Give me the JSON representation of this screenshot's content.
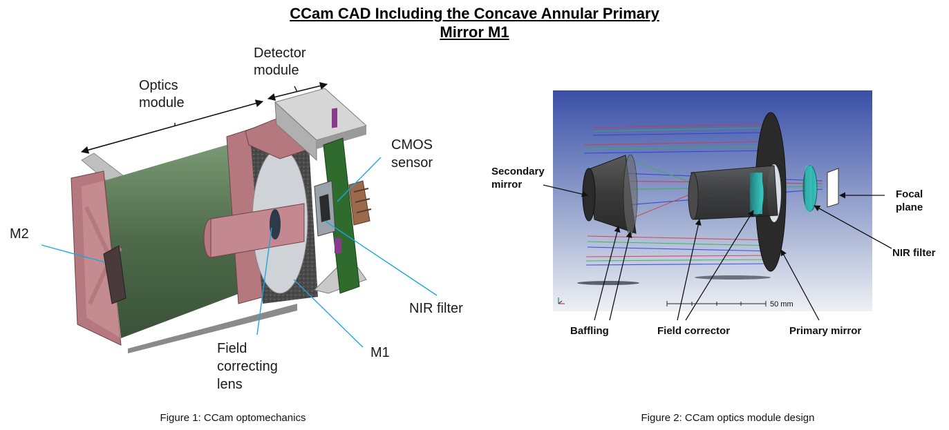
{
  "title": {
    "line1": "CCam CAD Including the Concave Annular Primary",
    "line2": "Mirror M1"
  },
  "figure1": {
    "caption": "Figure 1: CCam optomechanics",
    "labels": {
      "optics_line1": "Optics",
      "optics_line2": "module",
      "detector_line1": "Detector",
      "detector_line2": "module",
      "cmos_line1": "CMOS",
      "cmos_line2": "sensor",
      "m2": "M2",
      "nir_filter": "NIR filter",
      "m1": "M1",
      "fcl_line1": "Field",
      "fcl_line2": "correcting",
      "fcl_line3": "lens"
    }
  },
  "figure2": {
    "caption": "Figure 2: CCam optics module design",
    "scale_bar": "50 mm",
    "labels": {
      "secondary_line1": "Secondary",
      "secondary_line2": "mirror",
      "focal_line1": "Focal",
      "focal_line2": "plane",
      "nir_filter": "NIR filter",
      "baffling": "Baffling",
      "field_corrector": "Field corrector",
      "primary_mirror": "Primary mirror"
    }
  },
  "colors": {
    "housing_pink": "#b5787f",
    "inner_green": "#4e6a4a",
    "detector_gray": "#c9c9c9",
    "pcb_green": "#2f6b2c",
    "leader_cyan": "#1aa7e0",
    "render_bg_top": "#3a4fa8",
    "render_bg_bottom": "#e9ecf2",
    "mirror_dark": "#2b2b2b",
    "filter_teal": "#2fb3b0"
  }
}
